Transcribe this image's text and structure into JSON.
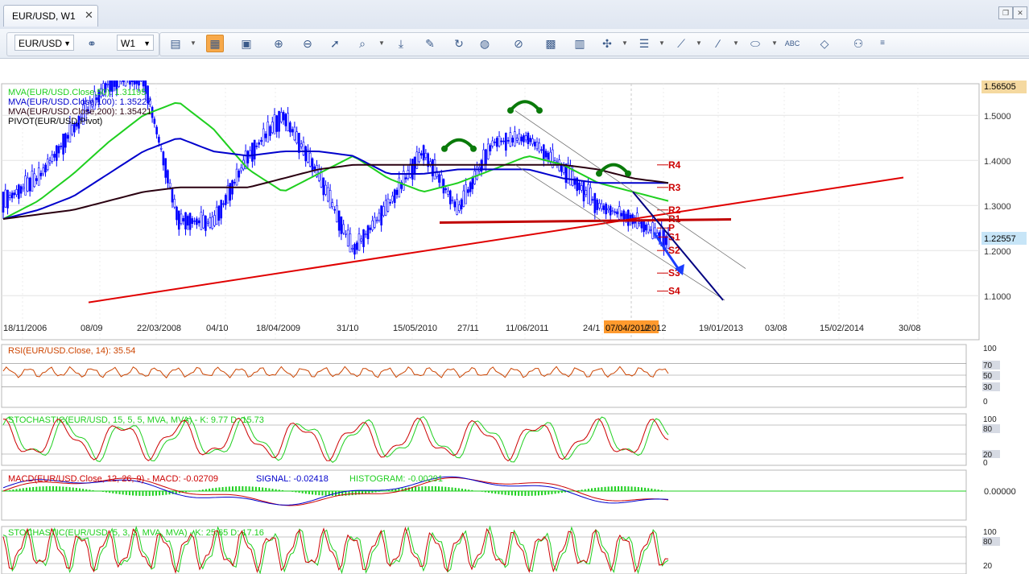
{
  "tab": {
    "title": "EUR/USD, W1",
    "close": "✕"
  },
  "window_buttons": [
    "restore-icon",
    "close-icon"
  ],
  "toolbar": {
    "symbol": "EUR/USD",
    "timeframe": "W1",
    "icons": [
      "link-icon",
      "bar-chart-icon",
      "candlestick-icon",
      "line-chart-icon",
      "zoom-in-icon",
      "zoom-out-icon",
      "cursor-icon",
      "fit-icon",
      "scroll-to-end-icon",
      "edit-icon",
      "refresh-icon",
      "globe-icon",
      "ruler-icon",
      "image-icon",
      "template-icon",
      "crosshair-icon",
      "lines-icon",
      "fan-icon",
      "pen-icon",
      "ellipse-icon",
      "text-icon",
      "eraser-icon",
      "tree-icon",
      "more-icon"
    ]
  },
  "colors": {
    "grid": "#c0c0c0",
    "candle": "#0000ff",
    "red_line": "#e00000",
    "pivot_text": "#cc0000",
    "current_price_bg": "#c7e5f7",
    "last_high_bg": "#f5d9a0",
    "date_highlight": "#ff9a2e",
    "green_hs": "#0a7a0a",
    "navy": "#000080"
  },
  "main_chart": {
    "legend": [
      {
        "text": "MVA(EUR/USD.Close,50): 1.31195",
        "color": "#1fcf1f"
      },
      {
        "text": "MVA(EUR/USD.Close,100): 1.35227",
        "color": "#0000cc"
      },
      {
        "text": "MVA(EUR/USD.Close,200): 1.35421",
        "color": "#2a0010"
      },
      {
        "text": "PIVOT(EUR/USD,Pivot)",
        "color": "#000000"
      }
    ],
    "price_axis": [
      "1.5000",
      "1.4000",
      "1.3000",
      "1.2000",
      "1.1000"
    ],
    "high_label": "1.56505",
    "current_label": "1.22557",
    "date_labels": [
      "18/11/2006",
      "08/09",
      "22/03/2008",
      "04/10",
      "18/04/2009",
      "31/10",
      "15/05/2010",
      "27/11",
      "11/06/2011",
      "24/1",
      "/2012",
      "19/01/2013",
      "03/08",
      "15/02/2014",
      "30/08"
    ],
    "date_highlight": "07/04/2012",
    "pivot_labels": [
      "R4",
      "R3",
      "R2",
      "R1",
      "P",
      "S1",
      "S2",
      "S3",
      "S4"
    ]
  },
  "chart_data": [
    {
      "type": "line",
      "title": "EUR/USD, W1",
      "ylim": [
        1.07,
        1.57
      ],
      "series": [
        {
          "name": "EUR/USD",
          "x": [
            "2006-11",
            "2007-06",
            "2008-01",
            "2008-04",
            "2008-07",
            "2008-10",
            "2009-03",
            "2009-06",
            "2009-11",
            "2010-02",
            "2010-06",
            "2010-09",
            "2010-11",
            "2011-01",
            "2011-04",
            "2011-06",
            "2011-09",
            "2011-12",
            "2012-01",
            "2012-04"
          ],
          "values": [
            1.31,
            1.36,
            1.47,
            1.57,
            1.59,
            1.27,
            1.26,
            1.41,
            1.5,
            1.37,
            1.2,
            1.3,
            1.42,
            1.29,
            1.44,
            1.45,
            1.38,
            1.3,
            1.27,
            1.22
          ]
        },
        {
          "name": "MVA(EUR/USD.Close,50)",
          "values": [
            1.27,
            1.31,
            1.37,
            1.44,
            1.5,
            1.53,
            1.47,
            1.38,
            1.33,
            1.37,
            1.41,
            1.36,
            1.33,
            1.35,
            1.38,
            1.41,
            1.39,
            1.35,
            1.33,
            1.31
          ]
        },
        {
          "name": "MVA(EUR/USD.Close,100)",
          "values": [
            1.27,
            1.29,
            1.32,
            1.37,
            1.42,
            1.45,
            1.42,
            1.41,
            1.42,
            1.42,
            1.41,
            1.37,
            1.37,
            1.38,
            1.38,
            1.38,
            1.36,
            1.35,
            1.35,
            1.35
          ]
        },
        {
          "name": "MVA(EUR/USD.Close,200)",
          "values": [
            1.27,
            1.28,
            1.29,
            1.31,
            1.33,
            1.34,
            1.34,
            1.34,
            1.36,
            1.38,
            1.39,
            1.39,
            1.39,
            1.39,
            1.39,
            1.39,
            1.39,
            1.38,
            1.36,
            1.35
          ]
        }
      ],
      "pivot_levels": {
        "R4": 1.39,
        "R3": 1.34,
        "R2": 1.29,
        "R1": 1.27,
        "P": 1.25,
        "S1": 1.23,
        "S2": 1.2,
        "S3": 1.15,
        "S4": 1.11
      },
      "annotations": [
        "head-and-shoulders (three arcs)",
        "rising trendline",
        "neckline",
        "descending channel",
        "projection arrow"
      ]
    },
    {
      "type": "line",
      "title": "RSI(EUR/USD.Close, 14): 35.54",
      "ylim": [
        0,
        100
      ],
      "levels": [
        100,
        70,
        50,
        30,
        0
      ],
      "value": 35.54
    },
    {
      "type": "line",
      "title": "STOCHASTIC(EUR/USD, 15, 5, 5, MVA, MVA) -  K: 9.77  D: 15.73",
      "ylim": [
        0,
        100
      ],
      "levels": [
        100,
        80,
        20,
        0
      ],
      "K": 9.77,
      "D": 15.73
    },
    {
      "type": "line",
      "title": "MACD(EUR/USD.Close, 12, 26, 9) -  MACD: -0.02709  SIGNAL: -0.02418  HISTOGRAM: -0.00291",
      "levels": [
        "0.00000"
      ],
      "MACD": -0.02709,
      "SIGNAL": -0.02418,
      "HISTOGRAM": -0.00291
    },
    {
      "type": "line",
      "title": "STOCHASTIC(EUR/USD, 5, 3, 3, MVA, MVA) -  K: 25.65  D: 17.16",
      "ylim": [
        0,
        100
      ],
      "levels": [
        100,
        80,
        20
      ],
      "K": 25.65,
      "D": 17.16
    }
  ],
  "panels": {
    "rsi": {
      "title": "RSI(EUR/USD.Close, 14): 35.54",
      "levels": [
        "100",
        "70",
        "50",
        "30",
        "0"
      ]
    },
    "stoch1": {
      "title": "STOCHASTIC(EUR/USD, 15, 5, 5, MVA, MVA) -  K: 9.77  D: 15.73",
      "levels": [
        "100",
        "80",
        "20",
        "0"
      ]
    },
    "macd": {
      "title": "MACD(EUR/USD.Close, 12, 26, 9) -  MACD: -0.02709",
      "signal": "SIGNAL: -0.02418",
      "hist": "HISTOGRAM: -0.00291",
      "levels": [
        "0.00000"
      ]
    },
    "stoch2": {
      "title": "STOCHASTIC(EUR/USD, 5, 3, 3, MVA, MVA) -  K: 25.65  D: 17.16",
      "levels": [
        "100",
        "80",
        "20"
      ]
    }
  }
}
